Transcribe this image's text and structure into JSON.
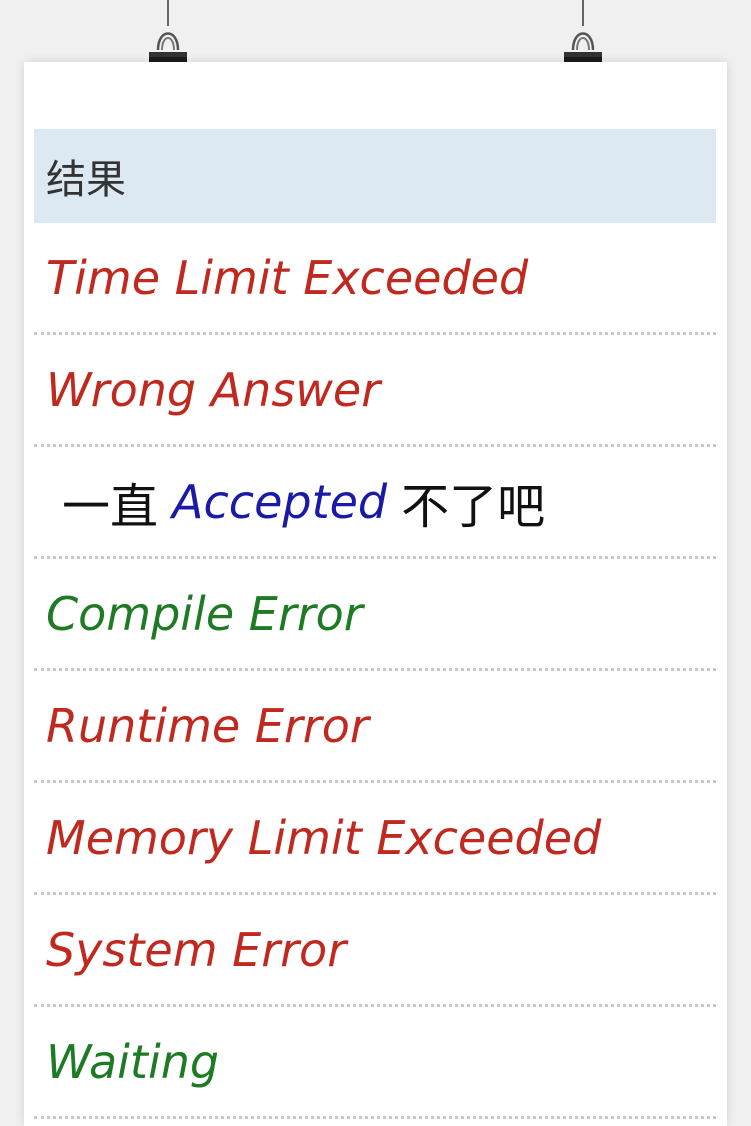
{
  "header": "结果",
  "rows": [
    {
      "text": "Time Limit Exceeded",
      "color": "#c0291f"
    },
    {
      "text": "Wrong Answer",
      "color": "#c0291f"
    },
    {
      "prefix": "一直",
      "text": "Accepted",
      "suffix": "不了吧",
      "color": "#1a1aa6"
    },
    {
      "text": "Compile Error",
      "color": "#1f7a26"
    },
    {
      "text": "Runtime Error",
      "color": "#c0291f"
    },
    {
      "text": "Memory Limit Exceeded",
      "color": "#c0291f"
    },
    {
      "text": "System Error",
      "color": "#c0291f"
    },
    {
      "text": "Waiting",
      "color": "#1f7a26"
    }
  ]
}
